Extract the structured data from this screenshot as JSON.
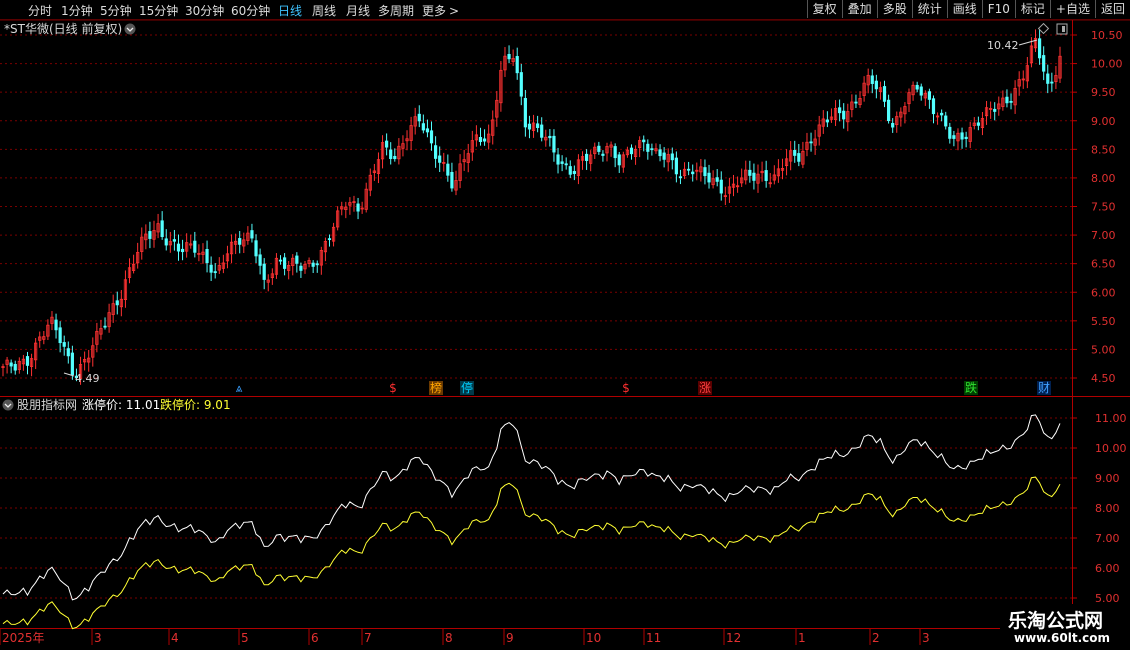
{
  "toolbar": {
    "timeframes": [
      {
        "label": "分时",
        "active": false
      },
      {
        "label": "1分钟",
        "active": false
      },
      {
        "label": "5分钟",
        "active": false
      },
      {
        "label": "15分钟",
        "active": false
      },
      {
        "label": "30分钟",
        "active": false
      },
      {
        "label": "60分钟",
        "active": false
      },
      {
        "label": "日线",
        "active": true
      },
      {
        "label": "周线",
        "active": false
      },
      {
        "label": "月线",
        "active": false
      },
      {
        "label": "多周期",
        "active": false
      },
      {
        "label": "更多",
        "active": false
      }
    ],
    "more_arrow": ">",
    "buttons": [
      "复权",
      "叠加",
      "多股",
      "统计",
      "画线",
      "F10",
      "标记",
      "+自选",
      "返回"
    ]
  },
  "main_chart": {
    "title": "*ST华微(日线 前复权)",
    "price_ticks": [
      "10.50",
      "10.00",
      "9.50",
      "9.00",
      "8.50",
      "8.00",
      "7.50",
      "7.00",
      "6.50",
      "6.00",
      "5.50",
      "5.00",
      "4.50"
    ],
    "low_label": "4.49",
    "high_label": "10.42",
    "markers": [
      {
        "text": "⩓",
        "color": "#3aa0ff"
      },
      {
        "text": "$",
        "color": "#ff3030"
      },
      {
        "text": "榜",
        "color": "#ffa500",
        "bg": "#6b3a00"
      },
      {
        "text": "停",
        "color": "#00d0ff",
        "bg": "#003a4a"
      },
      {
        "text": "$",
        "color": "#ff3030"
      },
      {
        "text": "涨",
        "color": "#ff4040",
        "bg": "#5a0000"
      },
      {
        "text": "跌",
        "color": "#30e030",
        "bg": "#004000"
      },
      {
        "text": "财",
        "color": "#40a0ff",
        "bg": "#002050"
      }
    ],
    "colors": {
      "up": "#ff3232",
      "down": "#54ffff",
      "grid": "#7a0000",
      "axis_text": "#e03030"
    }
  },
  "indicator": {
    "name": "股朋指标网",
    "label_up": "涨停价: 11.01",
    "label_down": "跌停价: 9.01",
    "ticks": [
      "11.00",
      "10.00",
      "9.00",
      "8.00",
      "7.00",
      "6.00",
      "5.00"
    ],
    "colors": {
      "up_line": "#ffffff",
      "down_line": "#ffff33"
    }
  },
  "xaxis": {
    "labels": [
      "2025年",
      "3",
      "4",
      "5",
      "6",
      "7",
      "8",
      "9",
      "10",
      "11",
      "12",
      "1",
      "2",
      "3"
    ]
  },
  "watermark": {
    "line1": "乐淘公式网",
    "line2": "www.60lt.com"
  },
  "chart_data": {
    "type": "candlestick",
    "title": "*ST华微(日线 前复权)",
    "ylim": [
      4.3,
      10.65
    ],
    "close_series": [
      4.7,
      4.65,
      4.8,
      5.2,
      5.45,
      5.1,
      4.6,
      4.8,
      5.2,
      5.7,
      6.0,
      6.5,
      7.0,
      7.2,
      6.8,
      6.7,
      6.9,
      6.6,
      6.2,
      6.8,
      7.0,
      6.9,
      6.1,
      6.6,
      6.5,
      6.4,
      6.5,
      6.8,
      7.2,
      7.6,
      7.5,
      8.0,
      8.5,
      8.4,
      8.8,
      9.0,
      8.6,
      8.3,
      7.8,
      8.4,
      8.8,
      8.7,
      9.9,
      10.2,
      9.0,
      8.8,
      8.6,
      8.3,
      8.1,
      8.3,
      8.5,
      8.6,
      8.2,
      8.5,
      8.7,
      8.4,
      8.3,
      8.1,
      8.2,
      8.0,
      7.9,
      7.8,
      7.95,
      8.0,
      8.1,
      8.0,
      8.3,
      8.4,
      8.7,
      8.9,
      9.1,
      9.2,
      9.4,
      9.7,
      9.5,
      8.9,
      9.3,
      9.6,
      9.4,
      9.0,
      8.6,
      8.8,
      9.0,
      9.1,
      9.3,
      9.5,
      9.8,
      10.4,
      9.6,
      10.1
    ]
  }
}
